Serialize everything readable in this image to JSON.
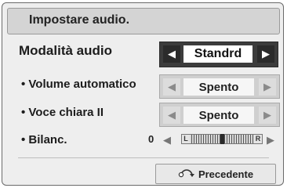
{
  "panel": {
    "title": "Impostare audio."
  },
  "audio_mode": {
    "label": "Modalità audio",
    "value": "Standrd"
  },
  "auto_volume": {
    "label": "• Volume automatico",
    "value": "Spento"
  },
  "clear_voice": {
    "label": "• Voce chiara II",
    "value": "Spento"
  },
  "balance": {
    "label": "• Bilanc.",
    "value": "0",
    "left_marker": "L",
    "right_marker": "R",
    "position": 0.5
  },
  "footer": {
    "back_label": "Precedente"
  },
  "icons": {
    "left": "left-arrow-icon",
    "right": "right-arrow-icon",
    "back": "return-arrow-icon"
  }
}
